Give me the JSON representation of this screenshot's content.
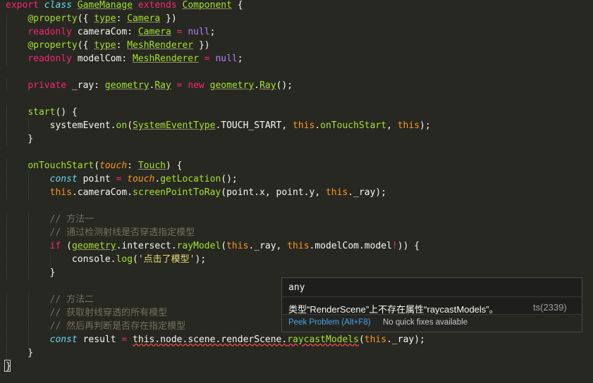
{
  "editor": {
    "lines": [
      [
        [
          "export",
          "keyword"
        ],
        [
          " ",
          "plain"
        ],
        [
          "class",
          "storage"
        ],
        [
          " ",
          "plain"
        ],
        [
          "GameManage",
          "class"
        ],
        [
          " ",
          "plain"
        ],
        [
          "extends",
          "keyword"
        ],
        [
          " ",
          "plain"
        ],
        [
          "Component",
          "class"
        ],
        [
          " {",
          "punct"
        ]
      ],
      [
        [
          "    ",
          "plain"
        ],
        [
          "@property",
          "decorator"
        ],
        [
          "({ ",
          "punct"
        ],
        [
          "type",
          "class"
        ],
        [
          ": ",
          "punct"
        ],
        [
          "Camera",
          "class"
        ],
        [
          " })",
          "punct"
        ]
      ],
      [
        [
          "    ",
          "plain"
        ],
        [
          "readonly",
          "keyword"
        ],
        [
          " cameraCom: ",
          "plain"
        ],
        [
          "Camera",
          "class"
        ],
        [
          " = ",
          "keyword"
        ],
        [
          "null",
          "const"
        ],
        [
          ";",
          "punct"
        ]
      ],
      [
        [
          "    ",
          "plain"
        ],
        [
          "@property",
          "decorator"
        ],
        [
          "({ ",
          "punct"
        ],
        [
          "type",
          "class"
        ],
        [
          ": ",
          "punct"
        ],
        [
          "MeshRenderer",
          "class"
        ],
        [
          " })",
          "punct"
        ]
      ],
      [
        [
          "    ",
          "plain"
        ],
        [
          "readonly",
          "keyword"
        ],
        [
          " modelCom: ",
          "plain"
        ],
        [
          "MeshRenderer",
          "class"
        ],
        [
          " = ",
          "keyword"
        ],
        [
          "null",
          "const"
        ],
        [
          ";",
          "punct"
        ]
      ],
      [],
      [
        [
          "    ",
          "plain"
        ],
        [
          "private",
          "keyword"
        ],
        [
          " _ray: ",
          "plain"
        ],
        [
          "geometry",
          "class"
        ],
        [
          ".",
          "punct"
        ],
        [
          "Ray",
          "class"
        ],
        [
          " = ",
          "keyword"
        ],
        [
          "new",
          "keyword"
        ],
        [
          " ",
          "plain"
        ],
        [
          "geometry",
          "class"
        ],
        [
          ".",
          "punct"
        ],
        [
          "Ray",
          "class"
        ],
        [
          "();",
          "punct"
        ]
      ],
      [],
      [
        [
          "    ",
          "plain"
        ],
        [
          "start",
          "func"
        ],
        [
          "() {",
          "punct"
        ]
      ],
      [
        [
          "        systemEvent.",
          "plain"
        ],
        [
          "on",
          "func"
        ],
        [
          "(",
          "punct"
        ],
        [
          "SystemEventType",
          "class"
        ],
        [
          ".TOUCH_START, ",
          "plain"
        ],
        [
          "this",
          "this"
        ],
        [
          ".",
          "punct"
        ],
        [
          "onTouchStart",
          "func"
        ],
        [
          ", ",
          "punct"
        ],
        [
          "this",
          "this"
        ],
        [
          ");",
          "punct"
        ]
      ],
      [
        [
          "    }",
          "punct"
        ]
      ],
      [],
      [
        [
          "    ",
          "plain"
        ],
        [
          "onTouchStart",
          "func"
        ],
        [
          "(",
          "punct"
        ],
        [
          "touch",
          "param"
        ],
        [
          ": ",
          "punct"
        ],
        [
          "Touch",
          "class"
        ],
        [
          ") {",
          "punct"
        ]
      ],
      [
        [
          "        ",
          "plain"
        ],
        [
          "const",
          "storage"
        ],
        [
          " point ",
          "plain"
        ],
        [
          "=",
          "keyword"
        ],
        [
          " ",
          "plain"
        ],
        [
          "touch",
          "param"
        ],
        [
          ".",
          "punct"
        ],
        [
          "getLocation",
          "func"
        ],
        [
          "();",
          "punct"
        ]
      ],
      [
        [
          "        ",
          "plain"
        ],
        [
          "this",
          "this"
        ],
        [
          ".cameraCom.",
          "plain"
        ],
        [
          "screenPointToRay",
          "func"
        ],
        [
          "(point.x, point.y, ",
          "plain"
        ],
        [
          "this",
          "this"
        ],
        [
          "._ray);",
          "plain"
        ]
      ],
      [],
      [
        [
          "        // 方法一",
          "comment"
        ]
      ],
      [
        [
          "        // 通过检测射线是否穿透指定模型",
          "comment"
        ]
      ],
      [
        [
          "        ",
          "plain"
        ],
        [
          "if",
          "keyword"
        ],
        [
          " (",
          "punct"
        ],
        [
          "geometry",
          "class"
        ],
        [
          ".intersect.",
          "plain"
        ],
        [
          "rayModel",
          "func"
        ],
        [
          "(",
          "punct"
        ],
        [
          "this",
          "this"
        ],
        [
          "._ray, ",
          "plain"
        ],
        [
          "this",
          "this"
        ],
        [
          ".modelCom.model",
          "plain"
        ],
        [
          "!",
          "keyword"
        ],
        [
          ")) {",
          "punct"
        ]
      ],
      [
        [
          "            console.",
          "plain"
        ],
        [
          "log",
          "func"
        ],
        [
          "(",
          "punct"
        ],
        [
          "'点击了模型'",
          "string"
        ],
        [
          ");",
          "punct"
        ]
      ],
      [
        [
          "        }",
          "punct"
        ]
      ],
      [],
      [
        [
          "        // 方法二",
          "comment"
        ]
      ],
      [
        [
          "        // 获取射线穿透的所有模型",
          "comment"
        ]
      ],
      [
        [
          "        // 然后再判断是否存在指定模型",
          "comment"
        ]
      ],
      [
        [
          "        ",
          "plain"
        ],
        [
          "const",
          "storage"
        ],
        [
          " result ",
          "plain"
        ],
        [
          "=",
          "keyword"
        ],
        [
          " ",
          "plain"
        ],
        [
          "this.node.scene.renderScene.",
          "error"
        ],
        [
          "raycastModels",
          "errfunc"
        ],
        [
          "(",
          "punct"
        ],
        [
          "this",
          "this"
        ],
        [
          "._ray);",
          "plain"
        ]
      ],
      [
        [
          "    }",
          "punct"
        ]
      ],
      [
        [
          "}",
          "punct"
        ]
      ]
    ]
  },
  "hover": {
    "header": "any",
    "message": "类型“RenderScene”上不存在属性“raycastModels”。",
    "code": "ts(2339)",
    "peek_label": "Peek Problem (Alt+F8)",
    "no_fix_label": "No quick fixes available",
    "link_color": "#4aa3f0"
  },
  "colors": {
    "background": "#272822",
    "keyword": "#f92672",
    "storage": "#66d9ef",
    "class": "#a6e22e",
    "this": "#fd971f",
    "string": "#e6db74",
    "comment": "#75715e",
    "constant": "#ae81ff",
    "error": "#f14c4c"
  }
}
